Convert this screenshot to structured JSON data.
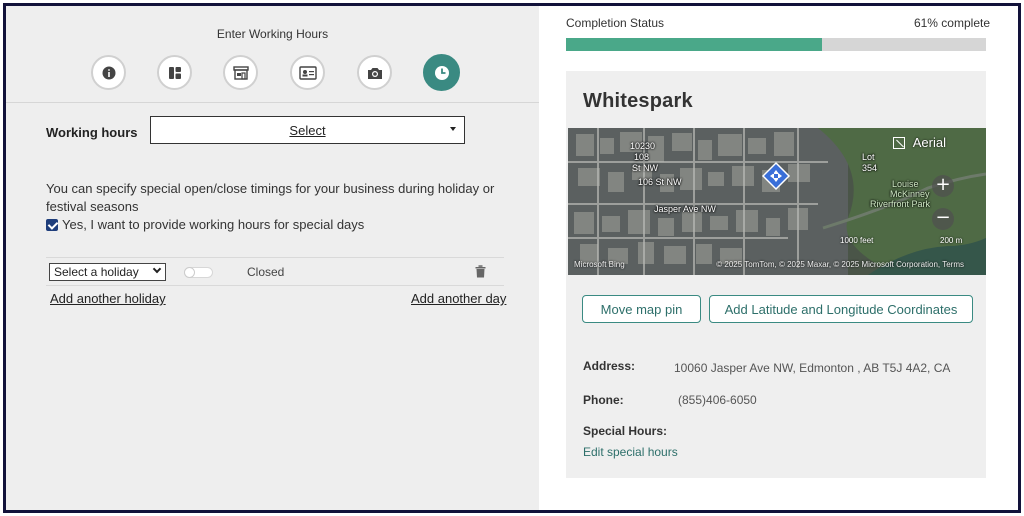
{
  "left": {
    "steps_title": "Enter Working Hours",
    "steps": [
      {
        "name": "info-icon"
      },
      {
        "name": "categories-icon"
      },
      {
        "name": "storefront-icon"
      },
      {
        "name": "contact-card-icon"
      },
      {
        "name": "camera-icon"
      },
      {
        "name": "clock-icon",
        "active": true
      }
    ],
    "working_hours_label": "Working hours",
    "working_hours_select": "Select",
    "special_desc": "You can specify special open/close timings for your business during holiday or festival seasons",
    "special_checkbox_label": "Yes, I want to provide working hours for special days",
    "special_checkbox_checked": true,
    "holiday_select": "Select a holiday",
    "holiday_closed_label": "Closed",
    "holiday_toggle_on": false,
    "add_holiday_link": "Add another holiday",
    "add_day_link": "Add another day"
  },
  "right": {
    "completion_label": "Completion Status",
    "completion_text": "61% complete",
    "completion_fraction": 0.61,
    "business_name": "Whitespark",
    "map": {
      "aerial_label": "Aerial",
      "labels": [
        "10230",
        "108",
        "St NW",
        "106 St NW",
        "Jasper Ave NW",
        "Lot",
        "354",
        "Louise",
        "McKinney",
        "Riverfront Park"
      ],
      "scale_feet": "1000 feet",
      "scale_m": "200 m",
      "ms_logo": "Microsoft Bing",
      "credit": "© 2025 TomTom, © 2025 Maxar, © 2025 Microsoft Corporation, Terms",
      "zoom_in": "+",
      "zoom_out": "−"
    },
    "move_pin_button": "Move map pin",
    "add_coords_button": "Add Latitude and Longitude Coordinates",
    "address_label": "Address:",
    "address_value": "10060 Jasper Ave NW, Edmonton , AB T5J 4A2, CA",
    "phone_label": "Phone:",
    "phone_value": "(855)406-6050",
    "special_hours_label": "Special Hours:",
    "edit_special_hours": "Edit special hours"
  },
  "colors": {
    "accent": "#3a8a82",
    "progress_fill": "#4aa889",
    "frame_border": "#12123a",
    "checkbox": "#1e3d7b"
  }
}
